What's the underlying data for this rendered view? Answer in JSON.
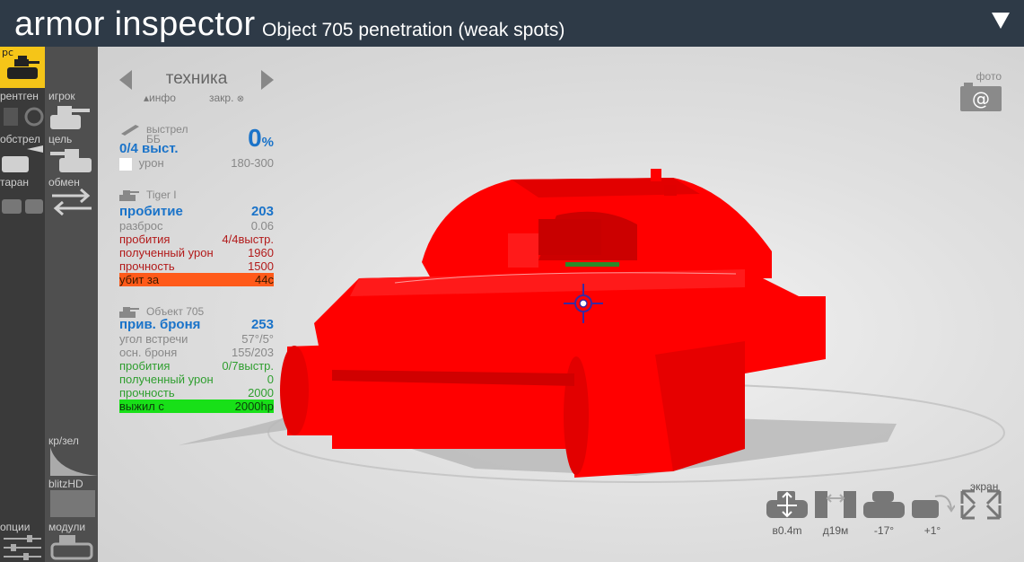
{
  "header": {
    "app_title": "armor inspector",
    "subtitle": "Object 705 penetration (weak spots)"
  },
  "sidebar": {
    "active_label": "рс",
    "xray_label": "рентген",
    "player_label": "игрок",
    "shelling_label": "обстрел",
    "target_label": "цель",
    "ram_label": "таран",
    "swap_label": "обмен",
    "redgreen_label": "кр/зел",
    "blitzhd_label": "blitzHD",
    "options_label": "опции",
    "modules_label": "модули"
  },
  "vehicle_nav": {
    "title": "техника",
    "info_label": "▴инфо",
    "close_label": "закр."
  },
  "shot": {
    "header": "выстрел",
    "ammo": "ББ",
    "shots": "0/4 выст.",
    "percent": "0",
    "percent_sign": "%",
    "damage_label": "урон",
    "damage_value": "180-300"
  },
  "attacker": {
    "name": "Tiger I",
    "penetration_label": "пробитие",
    "penetration_value": "203",
    "spread_label": "разброс",
    "spread_value": "0.06",
    "pen_label": "пробития",
    "pen_value": "4/4выстр.",
    "dmg_label": "полученный урон",
    "dmg_value": "1960",
    "hp_label": "прочность",
    "hp_value": "1500",
    "killed_label": "убит за",
    "killed_value": "44с"
  },
  "target": {
    "name": "Объект 705",
    "armor_label": "прив. броня",
    "armor_value": "253",
    "angle_label": "угол встречи",
    "angle_value": "57°/5°",
    "base_label": "осн. броня",
    "base_value": "155/203",
    "pen_label": "пробития",
    "pen_value": "0/7выстр.",
    "dmg_label": "полученный урон",
    "dmg_value": "0",
    "hp_label": "прочность",
    "hp_value": "2000",
    "survived_label": "выжил с",
    "survived_value": "2000hp"
  },
  "photo_label": "фото",
  "controls": {
    "height": "в0.4m",
    "distance": "д19м",
    "angle_v": "-17°",
    "angle_h": "+1°",
    "screen": "экран"
  },
  "colors": {
    "header_bg": "#2e3a47",
    "active_tool": "#f5c518",
    "tank_red": "#ff0000",
    "penetration_blue": "#1a73c9"
  }
}
